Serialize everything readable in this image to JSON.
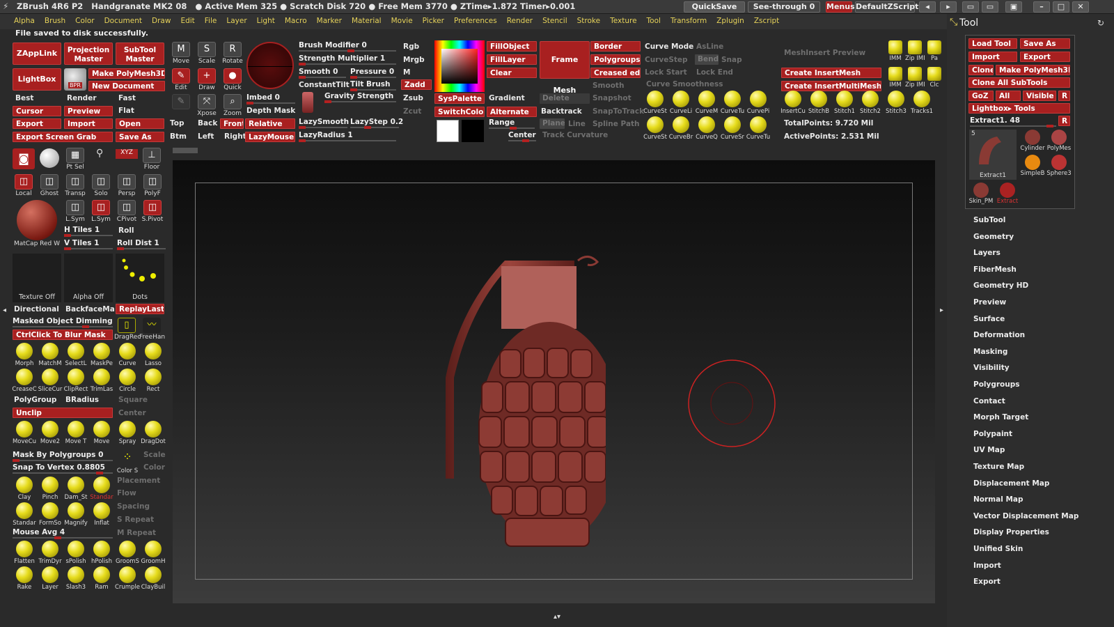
{
  "titlebar": {
    "app_title": "ZBrush 4R6 P2   Handgranate MK2 08   ● Active Mem 325 ● Scratch Disk 720 ● Free Mem 3770 ● ZTime▸1.872 Timer▸0.001",
    "quicksave": "QuickSave",
    "see_through": "See-through  0",
    "menus": "Menus",
    "default_zscript": "DefaultZScript"
  },
  "menubar": {
    "items": [
      "Alpha",
      "Brush",
      "Color",
      "Document",
      "Draw",
      "Edit",
      "File",
      "Layer",
      "Light",
      "Macro",
      "Marker",
      "Material",
      "Movie",
      "Picker",
      "Preferences",
      "Render",
      "Stencil",
      "Stroke",
      "Texture",
      "Tool",
      "Transform",
      "Zplugin",
      "Zscript"
    ]
  },
  "status": "File saved to disk successfully.",
  "top_shelf": {
    "zapplink": "ZAppLink",
    "projection_master": "Projection Master",
    "subtool_master": "SubTool Master",
    "lightbox": "LightBox",
    "bpr": "BPR",
    "make_polymesh3d": "Make PolyMesh3D",
    "new_document": "New Document",
    "best": "Best",
    "render": "Render",
    "fast": "Fast",
    "cursor": "Cursor",
    "preview": "Preview",
    "flat": "Flat",
    "export": "Export",
    "import": "Import",
    "open": "Open",
    "export_screen_grab": "Export Screen Grab",
    "save_as": "Save As",
    "move": "Move",
    "scale": "Scale",
    "rotate": "Rotate",
    "edit": "Edit",
    "draw": "Draw",
    "quick": "Quick",
    "xpose": "Xpose",
    "zoom": "Zoom",
    "top": "Top",
    "back": "Back",
    "front": "Front",
    "right": "Right",
    "btm": "Btm",
    "left": "Left",
    "brush_modifier": "Brush Modifier 0",
    "strength_multiplier": "Strength Multiplier 1",
    "smooth": "Smooth 0",
    "pressure": "Pressure 0",
    "constant_tilt": "ConstantTilt",
    "tilt_brush": "Tilt Brush",
    "imbed": "Imbed 0",
    "depth_mask": "Depth Mask",
    "gravity_strength": "Gravity Strength",
    "relative": "Relative",
    "lazymouse": "LazyMouse",
    "lazysmooth": "LazySmooth",
    "lazystep": "LazyStep 0.2",
    "lazyradius": "LazyRadius 1",
    "rgb": "Rgb",
    "mrgb": "Mrgb",
    "m": "M",
    "zadd": "Zadd",
    "zsub": "Zsub",
    "zcut": "Zcut",
    "fillobject": "FillObject",
    "filllayer": "FillLayer",
    "clear": "Clear",
    "syspalette": "SysPalette",
    "switchcolor": "SwitchColor",
    "gradient": "Gradient",
    "alternate": "Alternate",
    "frame_mesh": "Frame Mesh",
    "delete": "Delete",
    "backtrack": "Backtrack",
    "plane": "Plane",
    "line": "Line",
    "range": "Range",
    "center": "Center",
    "border": "Border",
    "polygroups": "Polygroups",
    "creased_edges": "Creased edg",
    "smooth_dim": "Smooth",
    "snapshot": "Snapshot",
    "snaptotrack": "SnapToTrack",
    "spline_path": "Spline Path",
    "track_curvature": "Track Curvature",
    "curve_mode": "Curve Mode",
    "aslines": "AsLine",
    "curvestep": "CurveStep",
    "bend": "Bend",
    "snap": "Snap",
    "lock_start": "Lock Start",
    "lock_end": "Lock End",
    "curve_smoothness": "Curve Smoothness",
    "curve_brushes_row1": [
      "CurveSt",
      "CurveLi",
      "CurveM",
      "CurveTu",
      "CurvePi"
    ],
    "curve_brushes_row2": [
      "CurveSt",
      "CurveBr",
      "CurveQ",
      "CurveSr",
      "CurveTu"
    ],
    "meshinsert_preview": "MeshInsert Preview",
    "create_insertmesh": "Create InsertMesh",
    "create_insertmultimesh": "Create InsertMultiMesh",
    "insert_brushes": [
      "InsertCu",
      "StitchB",
      "Stitch1",
      "Stitch2",
      "Stitch3",
      "Tracks1"
    ],
    "imm_icons": [
      "IMM",
      "Zip IMM",
      "Pa",
      "IMM",
      "Zip IMM",
      "Clc"
    ],
    "total_points": "TotalPoints: 9.720 Mil",
    "active_points": "ActivePoints: 2.531 Mil"
  },
  "left_shelf": {
    "icons_row1": [
      "Pt Sel",
      "Floor"
    ],
    "icons_row2": [
      "Local",
      "Ghost",
      "Transp",
      "Solo",
      "Persp",
      "PolyF"
    ],
    "icons_row3": [
      "L.Sym",
      "L.Sym",
      "CPivot",
      "S.Pivot"
    ],
    "matcap": "MatCap Red W",
    "h_tiles": "H Tiles 1",
    "v_tiles": "V Tiles 1",
    "roll": "Roll",
    "roll_dist": "Roll Dist 1",
    "texture_off": "Texture Off",
    "alpha_off": "Alpha Off",
    "dots": "Dots",
    "directional": "Directional",
    "backfacemask": "BackfaceMa",
    "replaylast": "ReplayLast",
    "masked_object_dimming": "Masked Object Dimming",
    "dragrect": "DragRec",
    "freehand": "FreeHan",
    "ctrlclick_blur_mask": "CtrlClick To Blur Mask",
    "brushes_row1": [
      "Morph",
      "MatchM",
      "SelectL",
      "MaskPe",
      "Curve",
      "Lasso"
    ],
    "brushes_row2": [
      "CreaseC",
      "SliceCur",
      "ClipRect",
      "TrimLas",
      "Circle",
      "Rect"
    ],
    "polygroup": "PolyGroup",
    "bradius": "BRadius",
    "square": "Square",
    "unclip": "Unclip",
    "center_dim": "Center",
    "brushes_row3": [
      "MoveCu",
      "Move2",
      "Move T",
      "Move",
      "Spray",
      "DragDot"
    ],
    "mask_by_polygroups": "Mask By Polygroups 0",
    "scale_dim": "Scale",
    "color_dim": "Color",
    "snap_to_vertex": "Snap To Vertex 0.8805",
    "color_s": "Color S",
    "placement": "Placement",
    "flow": "Flow",
    "spacing": "Spacing",
    "s_repeat": "S Repeat",
    "m_repeat": "M Repeat",
    "brushes_row4": [
      "Clay",
      "Pinch",
      "Dam_St",
      "Standar"
    ],
    "brushes_row5": [
      "Standar",
      "FormSo",
      "Magnify",
      "Inflat"
    ],
    "mouse_avg": "Mouse Avg 4",
    "brushes_row6": [
      "Flatten",
      "TrimDyr",
      "sPolish",
      "hPolish",
      "GroomS",
      "GroomH"
    ],
    "brushes_row7": [
      "Rake",
      "Layer",
      "Slash3",
      "Ram",
      "Crumple",
      "ClayBuil"
    ]
  },
  "tool_panel": {
    "title": "Tool",
    "load_tool": "Load Tool",
    "save_as": "Save As",
    "import": "Import",
    "export": "Export",
    "clone": "Clone",
    "make_polymesh3d": "Make PolyMesh3D",
    "clone_all_subtools": "Clone All SubTools",
    "goz": "GoZ",
    "all": "All",
    "visible": "Visible",
    "r": "R",
    "lightbox_tools": "Lightbox▸ Tools",
    "current_tool": "Extract1. 48",
    "tool_count": "5",
    "thumbs": [
      "Extract1",
      "Cylinder",
      "PolyMes",
      "SimpleB",
      "Sphere3",
      "Skin_PM",
      "Extract"
    ],
    "menu_items": [
      "SubTool",
      "Geometry",
      "Layers",
      "FiberMesh",
      "Geometry HD",
      "Preview",
      "Surface",
      "Deformation",
      "Masking",
      "Visibility",
      "Polygroups",
      "Contact",
      "Morph Target",
      "Polypaint",
      "UV Map",
      "Texture Map",
      "Displacement Map",
      "Normal Map",
      "Vector Displacement Map",
      "Display Properties",
      "Unified Skin",
      "Import",
      "Export"
    ]
  },
  "colors": {
    "accent_red": "#a82020",
    "brush_yellow": "#e6dc1c",
    "menu_yellow": "#e6d25a",
    "model_clay": "#8a3a34"
  }
}
